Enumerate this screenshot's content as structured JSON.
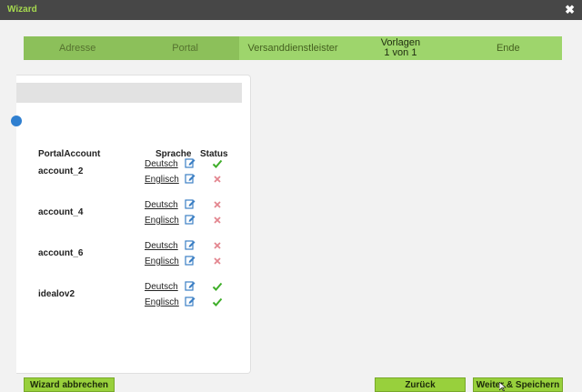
{
  "window": {
    "title": "Wizard",
    "close_glyph": "✖"
  },
  "steps": [
    {
      "label": "Adresse",
      "sub": "",
      "state": "done"
    },
    {
      "label": "Portal",
      "sub": "",
      "state": "done"
    },
    {
      "label": "Versanddienstleister",
      "sub": "",
      "state": "open"
    },
    {
      "label": "Vorlagen",
      "sub": "1 von 1",
      "state": "current"
    },
    {
      "label": "Ende",
      "sub": "",
      "state": "open"
    }
  ],
  "table": {
    "headers": {
      "account": "PortalAccount",
      "language": "Sprache",
      "status": "Status"
    },
    "accounts": [
      {
        "name": "account_2",
        "rows": [
          {
            "language": "Deutsch",
            "status": "ok"
          },
          {
            "language": "Englisch",
            "status": "missing"
          }
        ]
      },
      {
        "name": "account_4",
        "rows": [
          {
            "language": "Deutsch",
            "status": "missing"
          },
          {
            "language": "Englisch",
            "status": "missing"
          }
        ]
      },
      {
        "name": "account_6",
        "rows": [
          {
            "language": "Deutsch",
            "status": "missing"
          },
          {
            "language": "Englisch",
            "status": "missing"
          }
        ]
      },
      {
        "name": "idealov2",
        "rows": [
          {
            "language": "Deutsch",
            "status": "ok"
          },
          {
            "language": "Englisch",
            "status": "ok"
          }
        ]
      }
    ]
  },
  "buttons": {
    "cancel": "Wizard abbrechen",
    "back": "Zurück",
    "next": "Weiter & Speichern"
  },
  "colors": {
    "titlebar_bg": "#474747",
    "title_text": "#a6d94f",
    "button_bg": "#98d03c",
    "status_ok": "#3fae2a",
    "status_missing": "#e3868f",
    "edit_icon": "#3b7fc4"
  },
  "icons": {
    "edit": "edit-pencil-icon",
    "ok": "checkmark-icon",
    "missing": "cross-icon",
    "close": "close-icon",
    "info": "info-icon"
  }
}
